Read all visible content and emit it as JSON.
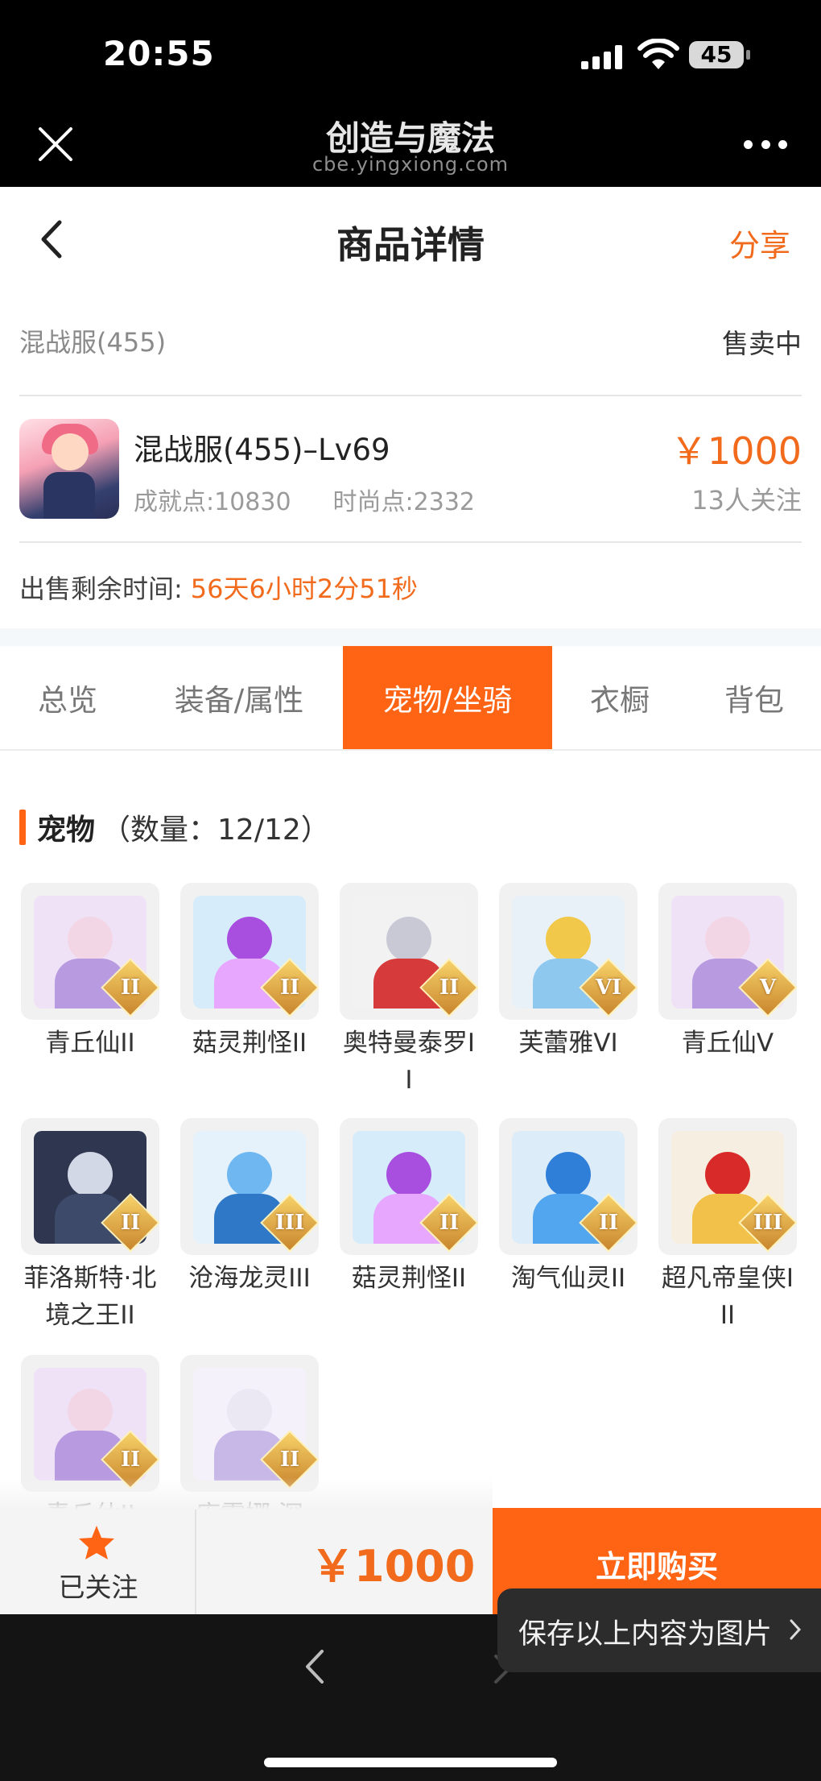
{
  "status_bar": {
    "time": "20:55",
    "battery": "45",
    "icons": [
      "signal-icon",
      "wifi-icon",
      "battery-icon"
    ]
  },
  "browser": {
    "title": "创造与魔法",
    "url": "cbe.yingxiong.com",
    "icons": [
      "close-icon",
      "more-icon"
    ]
  },
  "header": {
    "title": "商品详情",
    "share": "分享",
    "icons": [
      "back-arrow-icon"
    ]
  },
  "listing": {
    "server": "混战服(455)",
    "status": "售卖中",
    "product_name": "混战服(455)–Lv69",
    "achievement": "成就点:10830",
    "fashion": "时尚点:2332",
    "price": "￥1000",
    "watchers": "13人关注",
    "remaining_label": "出售剩余时间:",
    "remaining_value": "56天6小时2分51秒"
  },
  "tabs": [
    {
      "label": "总览",
      "active": false
    },
    {
      "label": "装备/属性",
      "active": false
    },
    {
      "label": "宠物/坐骑",
      "active": true
    },
    {
      "label": "衣橱",
      "active": false
    },
    {
      "label": "背包",
      "active": false
    }
  ],
  "pets_section": {
    "title": "宠物",
    "count": "（数量：12/12）",
    "items": [
      {
        "name": "青丘仙II",
        "tier": "II",
        "head": "#f3d6e6",
        "body": "#b89ae0",
        "bg": "#efe2f7"
      },
      {
        "name": "菇灵荆怪II",
        "tier": "II",
        "head": "#a84fe0",
        "body": "#e8a7ff",
        "bg": "#d6ecfa"
      },
      {
        "name": "奥特曼泰罗II",
        "tier": "II",
        "head": "#c9c9d6",
        "body": "#d63a3a",
        "bg": "#f2f2f2"
      },
      {
        "name": "芙蕾雅VI",
        "tier": "VI",
        "head": "#f2c84a",
        "body": "#8fc8ef",
        "bg": "#e9f1f8"
      },
      {
        "name": "青丘仙V",
        "tier": "V",
        "head": "#f3d6e6",
        "body": "#b89ae0",
        "bg": "#efe2f7"
      },
      {
        "name": "菲洛斯特·北境之王II",
        "tier": "II",
        "head": "#d2d8e6",
        "body": "#3d4a6a",
        "bg": "#2e3650"
      },
      {
        "name": "沧海龙灵III",
        "tier": "III",
        "head": "#6fb7f0",
        "body": "#2f78c7",
        "bg": "#e6f2fb"
      },
      {
        "name": "菇灵荆怪II",
        "tier": "II",
        "head": "#a84fe0",
        "body": "#e8a7ff",
        "bg": "#d6ecfa"
      },
      {
        "name": "淘气仙灵II",
        "tier": "II",
        "head": "#2f7fd9",
        "body": "#52a5ef",
        "bg": "#dcecf9"
      },
      {
        "name": "超凡帝皇侠III",
        "tier": "III",
        "head": "#d92a2a",
        "body": "#f2c14a",
        "bg": "#f6efe1"
      },
      {
        "name": "青丘仙II",
        "tier": "II",
        "head": "#f3d6e6",
        "body": "#b89ae0",
        "bg": "#efe2f7"
      },
      {
        "name": "库霏娜·深",
        "tier": "II",
        "head": "#ebe8f4",
        "body": "#c8b8e8",
        "bg": "#f4f1fa"
      }
    ]
  },
  "bottom_bar": {
    "follow_label": "已关注",
    "price": "￥1000",
    "buy_label": "立即购买"
  },
  "save_tip": {
    "label": "保存以上内容为图片"
  },
  "colors": {
    "accent": "#ff6414",
    "price": "#f26b1d"
  }
}
